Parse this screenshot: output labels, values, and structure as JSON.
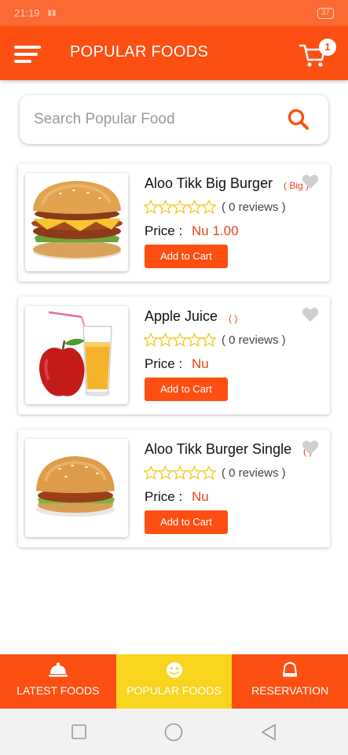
{
  "status_bar": {
    "time": "21:19",
    "battery": "37"
  },
  "app_bar": {
    "title": "POPULAR FOODS",
    "cart_count": "1"
  },
  "search": {
    "placeholder": "Search Popular Food",
    "value": ""
  },
  "foods": [
    {
      "name": "Aloo Tikk Big Burger",
      "variant": "( Big )",
      "rating": 0,
      "reviews": "( 0 reviews )",
      "price_label": "Price :",
      "price": "Nu 1.00",
      "button": "Add to Cart"
    },
    {
      "name": "Apple Juice",
      "variant": "( )",
      "rating": 0,
      "reviews": "( 0 reviews )",
      "price_label": "Price :",
      "price": "Nu",
      "button": "Add to Cart"
    },
    {
      "name": "Aloo Tikk Burger Single",
      "variant": "( )",
      "rating": 0,
      "reviews": "( 0 reviews )",
      "price_label": "Price :",
      "price": "Nu",
      "button": "Add to Cart"
    }
  ],
  "bottom_nav": [
    {
      "label": "LATEST FOODS",
      "icon": "cloche-icon",
      "active": false
    },
    {
      "label": "POPULAR FOODS",
      "icon": "smiley-icon",
      "active": true
    },
    {
      "label": "RESERVATION",
      "icon": "bell-icon",
      "active": false
    }
  ],
  "colors": {
    "primary": "#fd4f12",
    "accent": "#f8d51e",
    "price": "#e8441a",
    "star": "#f2c200"
  }
}
